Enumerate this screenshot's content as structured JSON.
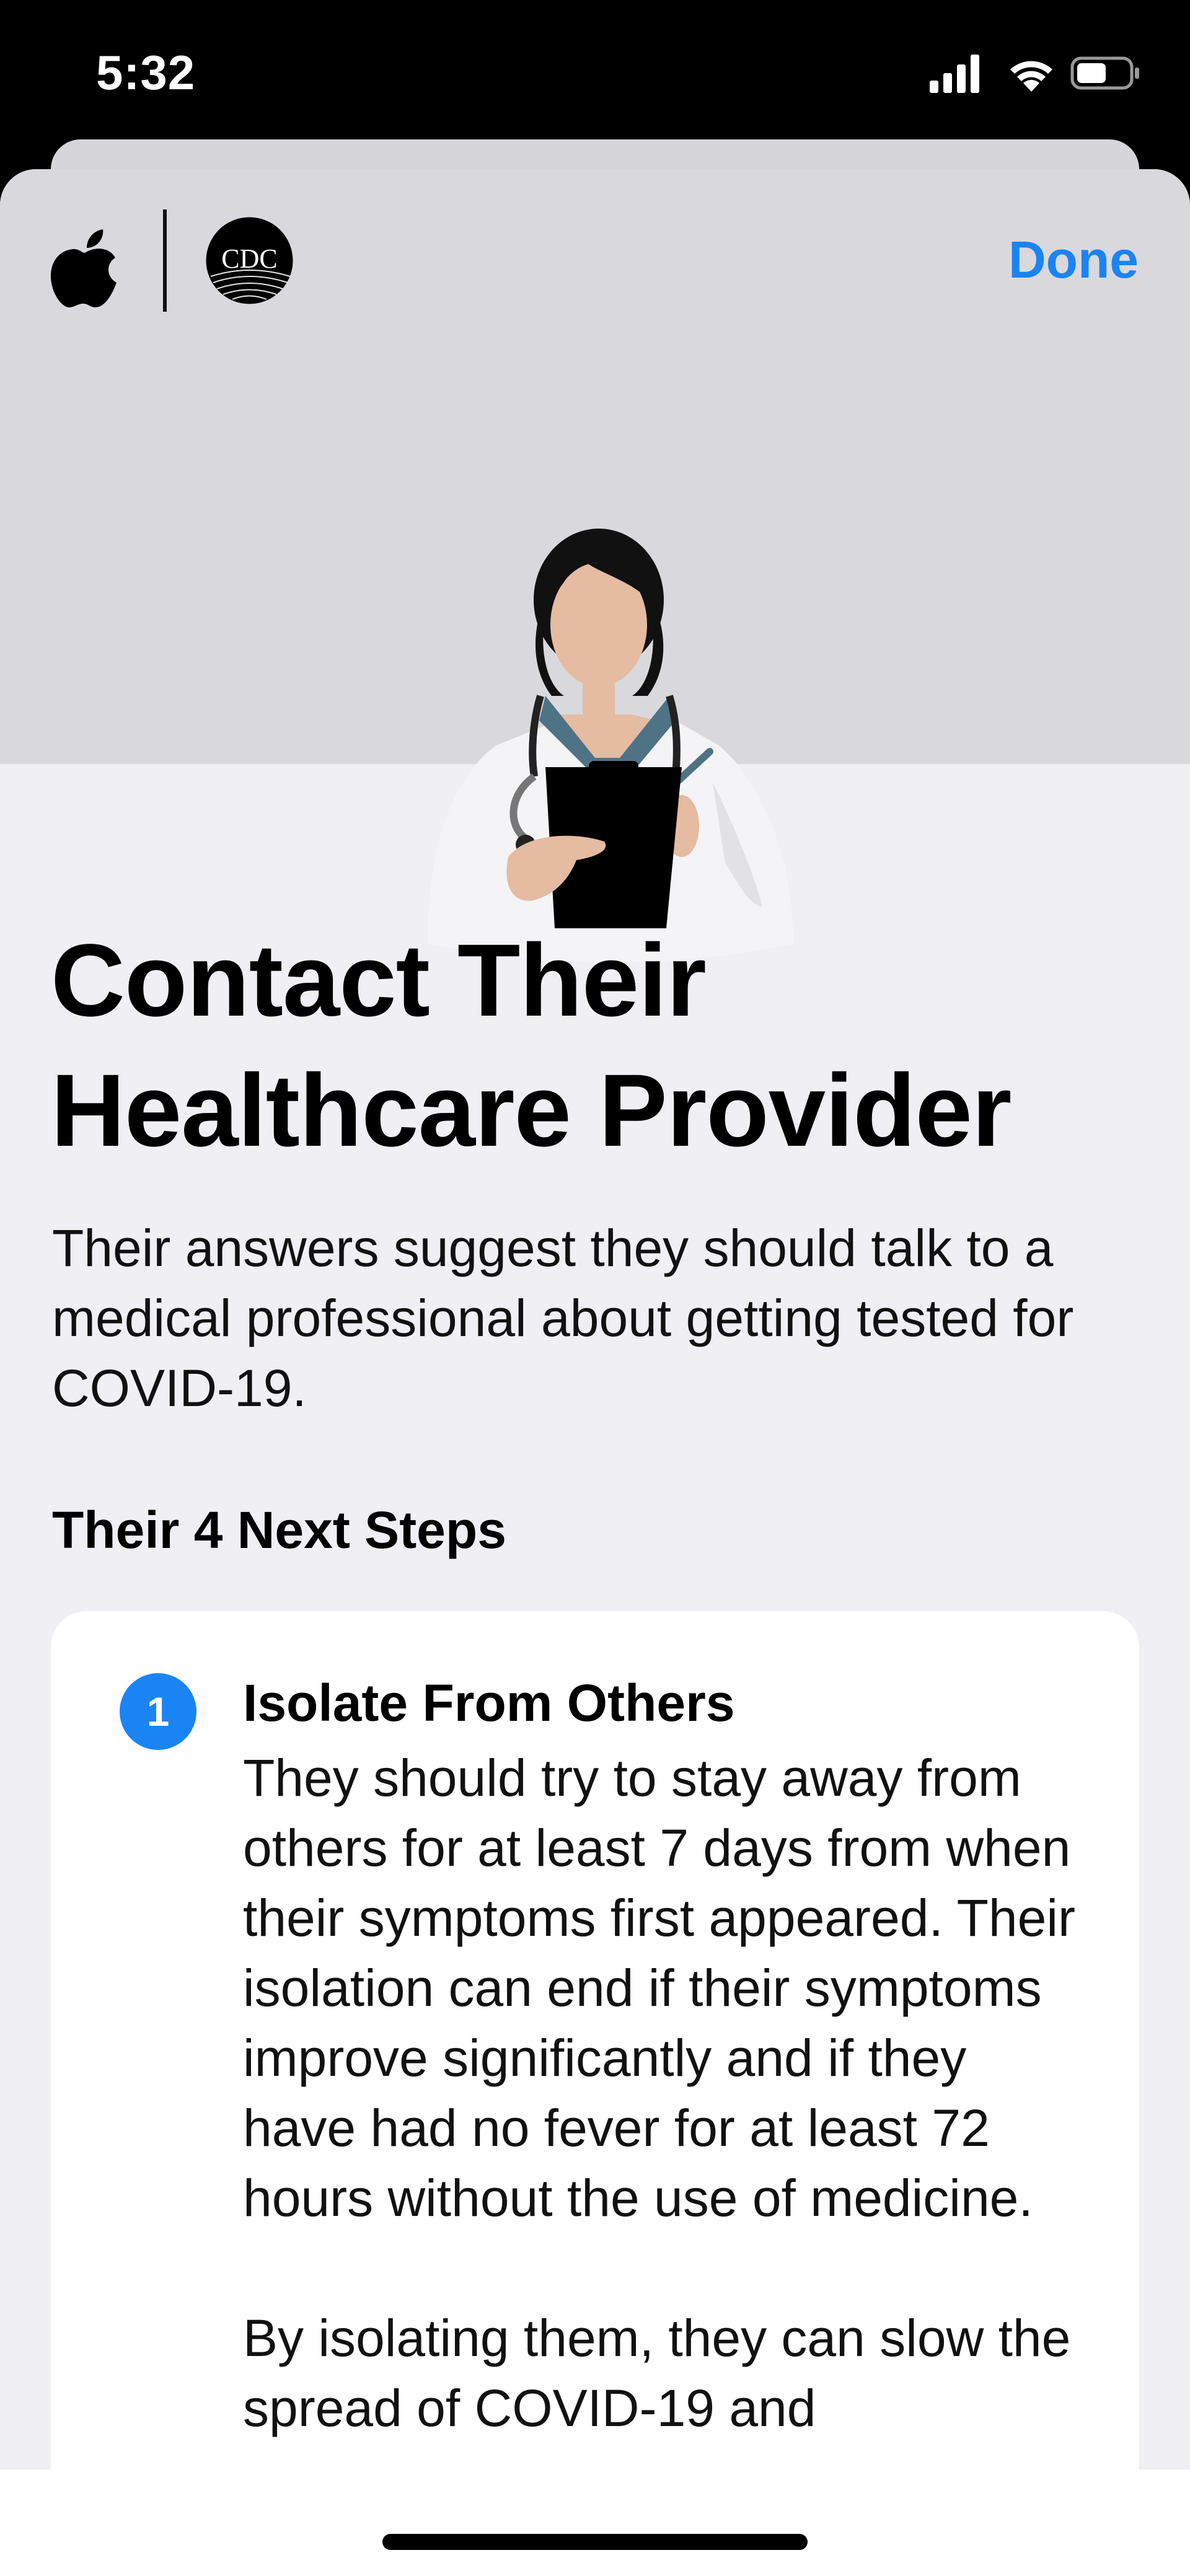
{
  "status_bar": {
    "time": "5:32",
    "icons": [
      "cellular-signal-icon",
      "wifi-icon",
      "battery-icon"
    ]
  },
  "header": {
    "logos": [
      "apple-logo",
      "cdc-logo"
    ],
    "cdc_logo_text": "CDC",
    "done_label": "Done"
  },
  "main": {
    "title": "Contact Their Healthcare Provider",
    "description": "Their answers suggest they should talk to a medical professional about getting tested for COVID-19.",
    "steps_heading": "Their 4 Next Steps",
    "steps": [
      {
        "number": "1",
        "title": "Isolate From Others",
        "text": "They should try to stay away from others for at least 7 days from when their symptoms first appeared. Their isolation can end if their symptoms improve significantly and if they have had no fever for at least 72 hours without the use of medicine.\n\nBy isolating them, they can slow the spread of COVID-19 and"
      }
    ]
  },
  "colors": {
    "accent": "#1a84f5",
    "hero_background": "#d9d9dd",
    "sheet_background": "#efeff4"
  }
}
